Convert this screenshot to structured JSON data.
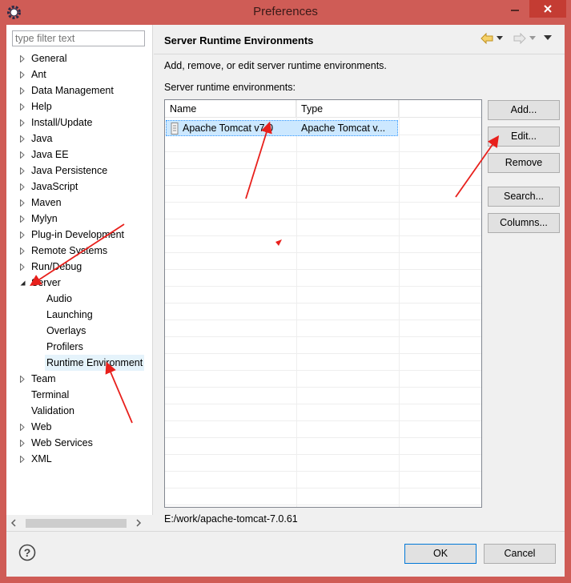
{
  "window": {
    "title": "Preferences"
  },
  "filter": {
    "placeholder": "type filter text"
  },
  "tree": [
    {
      "label": "General",
      "twisty": "collapsed"
    },
    {
      "label": "Ant",
      "twisty": "collapsed"
    },
    {
      "label": "Data Management",
      "twisty": "collapsed"
    },
    {
      "label": "Help",
      "twisty": "collapsed"
    },
    {
      "label": "Install/Update",
      "twisty": "collapsed"
    },
    {
      "label": "Java",
      "twisty": "collapsed"
    },
    {
      "label": "Java EE",
      "twisty": "collapsed"
    },
    {
      "label": "Java Persistence",
      "twisty": "collapsed"
    },
    {
      "label": "JavaScript",
      "twisty": "collapsed"
    },
    {
      "label": "Maven",
      "twisty": "collapsed"
    },
    {
      "label": "Mylyn",
      "twisty": "collapsed"
    },
    {
      "label": "Plug-in Development",
      "twisty": "collapsed"
    },
    {
      "label": "Remote Systems",
      "twisty": "collapsed"
    },
    {
      "label": "Run/Debug",
      "twisty": "collapsed"
    },
    {
      "label": "Server",
      "twisty": "expanded"
    },
    {
      "label": "Audio",
      "twisty": "none",
      "child": true
    },
    {
      "label": "Launching",
      "twisty": "none",
      "child": true
    },
    {
      "label": "Overlays",
      "twisty": "none",
      "child": true
    },
    {
      "label": "Profilers",
      "twisty": "none",
      "child": true
    },
    {
      "label": "Runtime Environment",
      "twisty": "none",
      "child": true,
      "selected": true
    },
    {
      "label": "Team",
      "twisty": "collapsed"
    },
    {
      "label": "Terminal",
      "twisty": "none"
    },
    {
      "label": "Validation",
      "twisty": "none"
    },
    {
      "label": "Web",
      "twisty": "collapsed"
    },
    {
      "label": "Web Services",
      "twisty": "collapsed"
    },
    {
      "label": "XML",
      "twisty": "collapsed"
    }
  ],
  "page": {
    "title": "Server Runtime Environments",
    "description": "Add, remove, or edit server runtime environments.",
    "list_label": "Server runtime environments:",
    "columns": [
      "Name",
      "Type"
    ],
    "rows": [
      {
        "name": "Apache Tomcat v7.0",
        "type": "Apache Tomcat v..."
      }
    ],
    "location": "E:/work/apache-tomcat-7.0.61"
  },
  "buttons": {
    "add": "Add...",
    "edit": "Edit...",
    "remove": "Remove",
    "search": "Search...",
    "columns": "Columns...",
    "ok": "OK",
    "cancel": "Cancel"
  },
  "icons": {
    "app": "eclipse-gear-icon",
    "help": "help-icon",
    "server_runtime": "server-icon",
    "back": "back-arrow-icon",
    "forward": "forward-arrow-icon"
  },
  "colors": {
    "title_bar": "#cf5c56",
    "selection": "#cce8ff",
    "tree_selection": "#e5f3fb",
    "annotation_arrow": "#e8201c"
  }
}
